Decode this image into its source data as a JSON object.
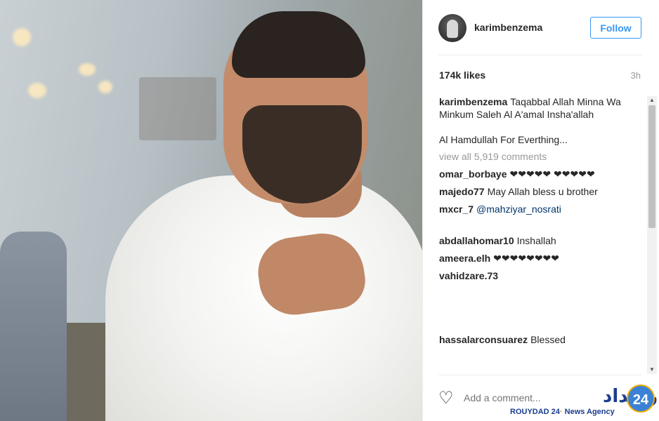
{
  "post": {
    "username": "karimbenzema",
    "follow_label": "Follow",
    "likes": "174k likes",
    "time": "3h"
  },
  "comments": {
    "caption_user": "karimbenzema",
    "caption_text": "Taqabbal Allah Minna Wa Minkum Saleh Al A'amal Insha'allah",
    "caption_line2": "Al Hamdullah For Everthing...",
    "view_all": "view all 5,919 comments",
    "items": [
      {
        "user": "omar_borbaye",
        "text": "❤❤❤❤❤ ❤❤❤❤❤"
      },
      {
        "user": "majedo77",
        "text": "May Allah bless u brother"
      },
      {
        "user": "mxcr_7",
        "text": "@mahziyar_nosrati"
      },
      {
        "user": "abdallahomar10",
        "text": "Inshallah"
      },
      {
        "user": "ameera.elh",
        "text": "❤❤❤❤❤❤❤❤"
      },
      {
        "user": "vahidzare.73",
        "text": ""
      },
      {
        "user": "hassalarconsuarez",
        "text": "Blessed"
      }
    ]
  },
  "footer": {
    "add_comment_placeholder": "Add a comment..."
  },
  "watermark": {
    "agency": "ROUYDAD 24",
    "agency_suffix": "News Agency",
    "logo_number": "24"
  },
  "colors": {
    "accent": "#3897f0",
    "text": "#262626",
    "muted": "#999999"
  }
}
